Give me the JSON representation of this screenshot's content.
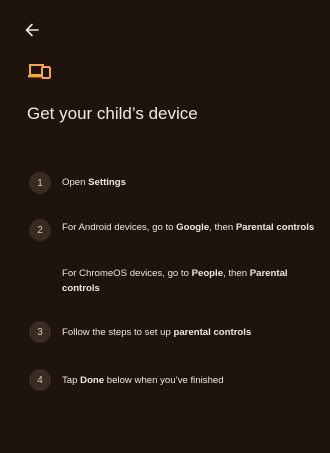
{
  "header": {
    "back_icon": "arrow-left-icon",
    "device_icon": "devices-icon",
    "accent_color": "#f6a74a"
  },
  "title": "Get your child’s device",
  "steps": [
    {
      "number": "1",
      "segments": [
        {
          "text": "Open ",
          "bold": false
        },
        {
          "text": "Settings",
          "bold": true
        }
      ]
    },
    {
      "number": "2",
      "segments": [
        {
          "text": "For Android devices, go to ",
          "bold": false
        },
        {
          "text": "Google",
          "bold": true
        },
        {
          "text": ", then ",
          "bold": false
        },
        {
          "text": "Parental controls",
          "bold": true
        }
      ],
      "sub": [
        {
          "text": "For ChromeOS devices, go to ",
          "bold": false
        },
        {
          "text": "People",
          "bold": true
        },
        {
          "text": ", then ",
          "bold": false
        },
        {
          "text": "Parental controls",
          "bold": true
        }
      ]
    },
    {
      "number": "3",
      "segments": [
        {
          "text": "Follow the steps to set up ",
          "bold": false
        },
        {
          "text": "parental controls",
          "bold": true
        }
      ]
    },
    {
      "number": "4",
      "segments": [
        {
          "text": "Tap ",
          "bold": false
        },
        {
          "text": "Done",
          "bold": true
        },
        {
          "text": " below when you’ve finished",
          "bold": false
        }
      ]
    }
  ]
}
